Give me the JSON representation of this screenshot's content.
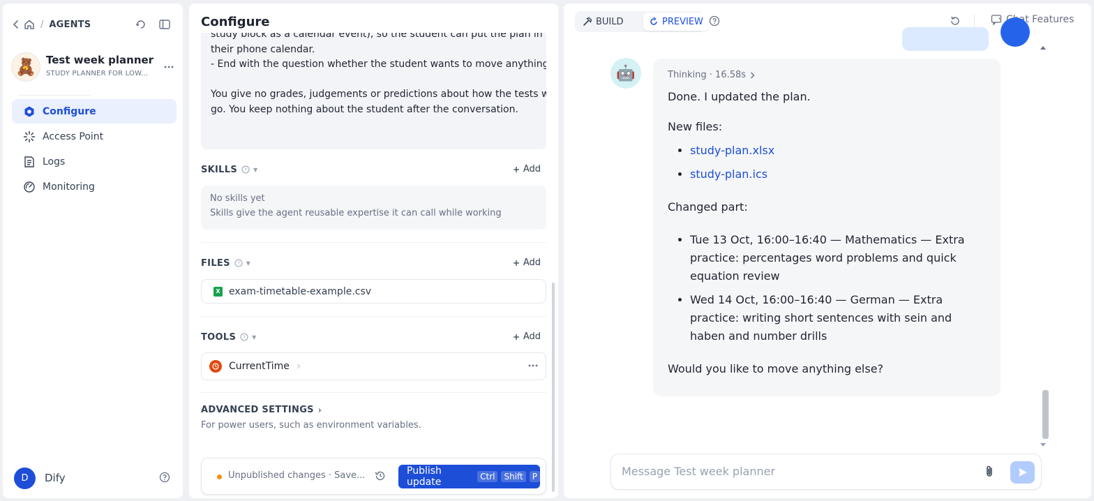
{
  "sidebar": {
    "breadcrumb_title": "AGENTS",
    "app_name": "Test week planner",
    "app_subtitle": "STUDY PLANNER FOR LOW...",
    "nav": [
      {
        "label": "Configure",
        "icon": "configure-icon",
        "active": true
      },
      {
        "label": "Access Point",
        "icon": "access-point-icon",
        "active": false
      },
      {
        "label": "Logs",
        "icon": "logs-icon",
        "active": false
      },
      {
        "label": "Monitoring",
        "icon": "monitoring-icon",
        "active": false
      }
    ],
    "user_initial": "D",
    "user_name": "Dify"
  },
  "config": {
    "title": "Configure",
    "prompt_lines": [
      "study block as a calendar event), so the student can put the plan in",
      "their phone calendar.",
      "- End with the question whether the student wants to move anything.",
      "",
      "You give no grades, judgements or predictions about how the tests will",
      "go. You keep nothing about the student after the conversation."
    ],
    "skills": {
      "label": "SKILLS",
      "add": "Add",
      "empty_title": "No skills yet",
      "empty_desc": "Skills give the agent reusable expertise it can call while working"
    },
    "files": {
      "label": "FILES",
      "add": "Add",
      "items": [
        "exam-timetable-example.csv"
      ]
    },
    "tools": {
      "label": "TOOLS",
      "add": "Add",
      "items": [
        "CurrentTime"
      ]
    },
    "advanced": {
      "label": "ADVANCED SETTINGS",
      "desc": "For power users, such as environment variables."
    },
    "publish": {
      "status": "Unpublished changes · Save...",
      "button": "Publish update",
      "kbd": [
        "Ctrl",
        "Shift",
        "P"
      ]
    }
  },
  "preview": {
    "mode_build": "BUILD",
    "mode_preview": "PREVIEW",
    "chat_features": "Chat Features",
    "thinking_label": "Thinking · 16.58s",
    "message": {
      "intro": "Done. I updated the plan.",
      "new_files_label": "New files:",
      "files": [
        "study-plan.xlsx",
        "study-plan.ics"
      ],
      "changed_label": "Changed part:",
      "changes": [
        "Tue 13 Oct, 16:00–16:40 — Mathematics — Extra practice: percentages word problems and quick equation review",
        "Wed 14 Oct, 16:00–16:40 — German — Extra practice: writing short sentences with sein and haben and number drills"
      ],
      "outro": "Would you like to move anything else?"
    },
    "input_placeholder": "Message Test week planner"
  },
  "colors": {
    "accent": "#1d4ed8",
    "active_nav_bg": "#eaf0fe",
    "warning_dot": "#f79009",
    "tool_icon": "#e4480f"
  }
}
